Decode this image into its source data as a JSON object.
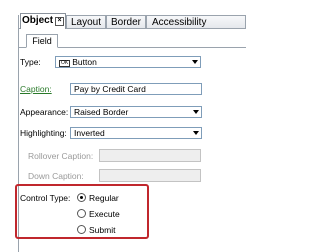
{
  "tabs": [
    {
      "label": "Object",
      "active": true
    },
    {
      "label": "Layout",
      "active": false
    },
    {
      "label": "Border",
      "active": false
    },
    {
      "label": "Accessibility",
      "active": false
    }
  ],
  "close_glyph": "×",
  "subtab": {
    "label": "Field"
  },
  "form": {
    "type": {
      "label": "Type:",
      "badge": "OK",
      "value": "Button"
    },
    "caption": {
      "label": "Caption:",
      "value": "Pay by Credit Card"
    },
    "appearance": {
      "label": "Appearance:",
      "value": "Raised Border"
    },
    "highlighting": {
      "label": "Highlighting:",
      "value": "Inverted"
    },
    "rollover_caption": {
      "label": "Rollover Caption:",
      "value": ""
    },
    "down_caption": {
      "label": "Down Caption:",
      "value": ""
    },
    "control_type": {
      "label": "Control Type:",
      "options": [
        {
          "label": "Regular",
          "selected": true
        },
        {
          "label": "Execute",
          "selected": false
        },
        {
          "label": "Submit",
          "selected": false
        }
      ]
    }
  },
  "colors": {
    "highlight_border": "#c0272d",
    "link_green": "#2a7a2a"
  }
}
